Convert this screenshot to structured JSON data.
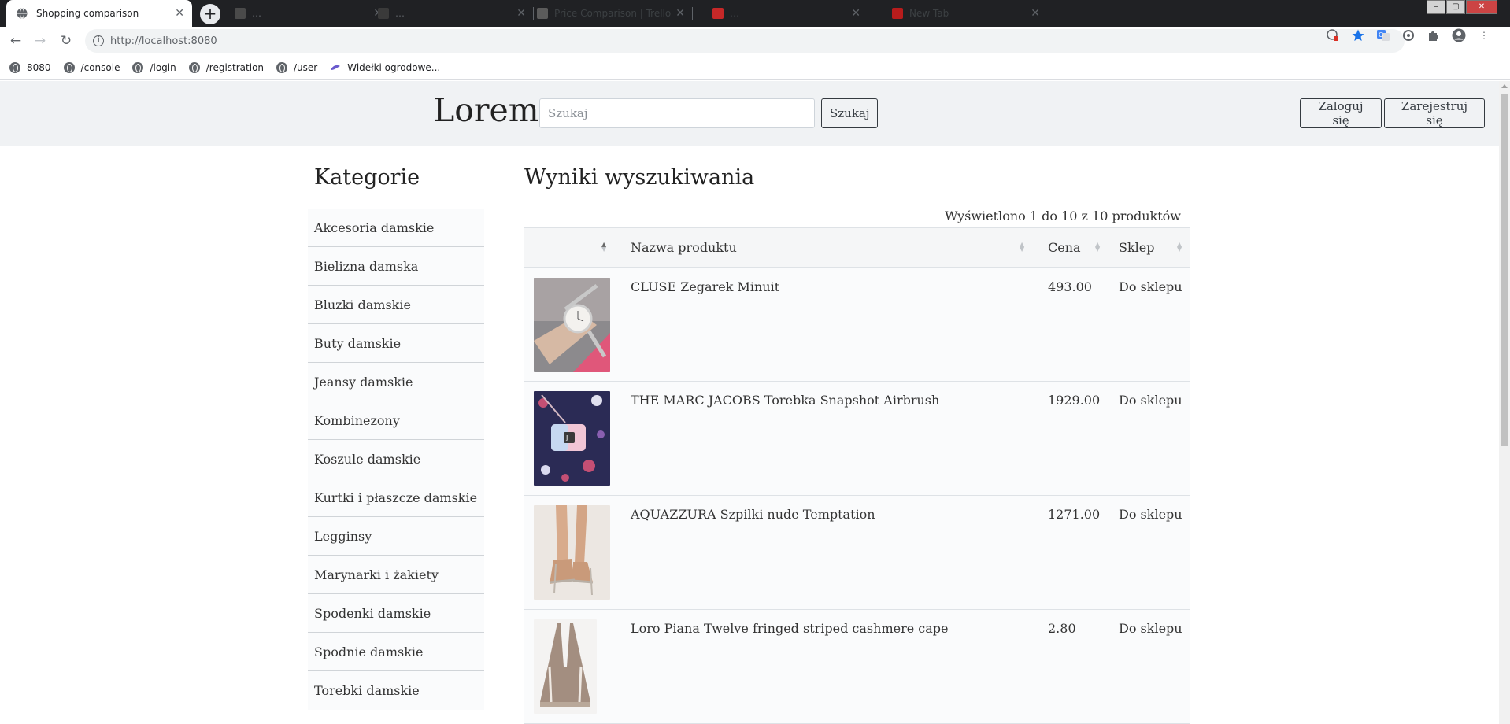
{
  "browser": {
    "active_tab_title": "Shopping comparison",
    "background_tabs": [
      {
        "title": "…",
        "color": "#4a4a4a"
      },
      {
        "title": "…",
        "color": "#3a3a3a"
      },
      {
        "title": "Price Comparison | Trello",
        "color": "#5b5b5b"
      },
      {
        "title": "…",
        "color": "#c62828"
      },
      {
        "title": "New Tab",
        "color": "#b71c1c"
      }
    ],
    "url": "http://localhost:8080",
    "bookmarks": [
      {
        "label": "8080",
        "icon": "globe-icon"
      },
      {
        "label": "/console",
        "icon": "globe-icon"
      },
      {
        "label": "/login",
        "icon": "globe-icon"
      },
      {
        "label": "/registration",
        "icon": "globe-icon"
      },
      {
        "label": "/user",
        "icon": "globe-icon"
      },
      {
        "label": "Widełki ogrodowe...",
        "icon": "leaf-icon"
      }
    ]
  },
  "header": {
    "brand": "Lorem",
    "search_placeholder": "Szukaj",
    "search_button": "Szukaj",
    "login_button": "Zaloguj się",
    "register_button": "Zarejestruj się"
  },
  "sidebar": {
    "title": "Kategorie",
    "items": [
      "Akcesoria damskie",
      "Bielizna damska",
      "Bluzki damskie",
      "Buty damskie",
      "Jeansy damskie",
      "Kombinezony",
      "Koszule damskie",
      "Kurtki i płaszcze damskie",
      "Legginsy",
      "Marynarki i żakiety",
      "Spodenki damskie",
      "Spodnie damskie",
      "Torebki damskie"
    ]
  },
  "results": {
    "title": "Wyniki wyszukiwania",
    "count_text": "Wyświetlono 1 do 10 z 10 produktów",
    "columns": {
      "image": "",
      "name": "Nazwa produktu",
      "price": "Cena",
      "shop": "Sklep"
    },
    "rows": [
      {
        "name": "CLUSE Zegarek Minuit",
        "price": "493.00",
        "shop": "Do sklepu",
        "image": "watch-photo"
      },
      {
        "name": "THE MARC JACOBS Torebka Snapshot Airbrush",
        "price": "1929.00",
        "shop": "Do sklepu",
        "image": "bag-photo"
      },
      {
        "name": "AQUAZZURA Szpilki nude Temptation",
        "price": "1271.00",
        "shop": "Do sklepu",
        "image": "heels-photo"
      },
      {
        "name": "Loro Piana Twelve fringed striped cashmere cape",
        "price": "2.80",
        "shop": "Do sklepu",
        "image": "cape-photo"
      }
    ]
  }
}
